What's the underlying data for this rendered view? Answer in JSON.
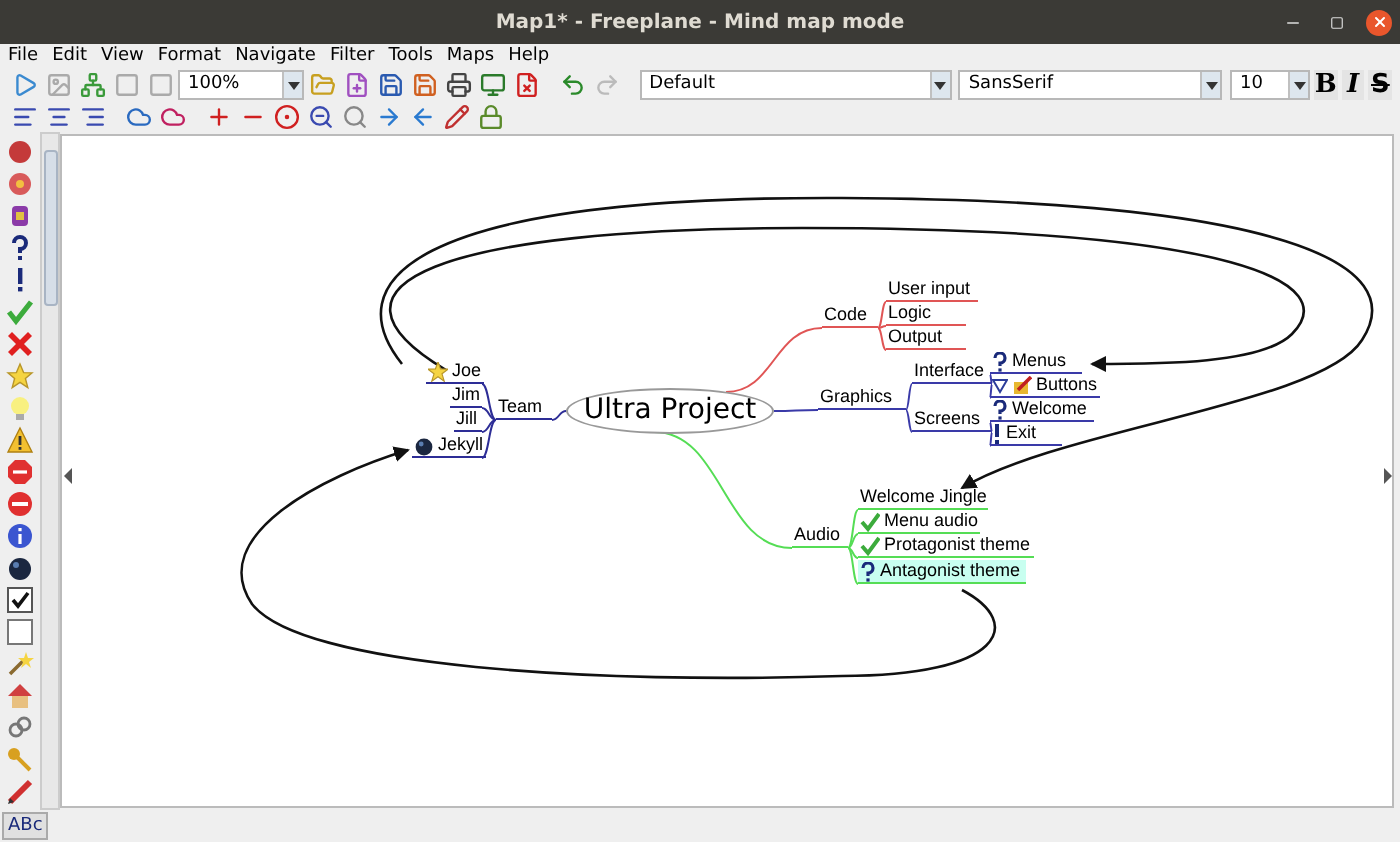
{
  "window": {
    "title": "Map1* - Freeplane - Mind map mode"
  },
  "menu": [
    "File",
    "Edit",
    "View",
    "Format",
    "Navigate",
    "Filter",
    "Tools",
    "Maps",
    "Help"
  ],
  "toolbar": {
    "zoom": "100%",
    "style": "Default",
    "font": "SansSerif",
    "size": "10",
    "format_buttons": [
      {
        "label": "B",
        "kind": "bold"
      },
      {
        "label": "I",
        "kind": "italic"
      },
      {
        "label": "S",
        "kind": "strike"
      }
    ]
  },
  "status_button": "ABc",
  "mind_map": {
    "root": {
      "text": "Ultra Project",
      "selected": false
    },
    "branches": [
      {
        "text": "Team",
        "color": "#2d2d96",
        "selected": false,
        "children": [
          {
            "text": "Joe",
            "icons": [
              {
                "kind": "star"
              }
            ],
            "selected": false
          },
          {
            "text": "Jim",
            "selected": false
          },
          {
            "text": "Jill",
            "selected": false
          },
          {
            "text": "Jekyll",
            "icons": [
              {
                "kind": "bomb"
              }
            ],
            "selected": false
          }
        ]
      },
      {
        "text": "Code",
        "color": "#e05555",
        "selected": false,
        "children": [
          {
            "text": "User input",
            "selected": false
          },
          {
            "text": "Logic",
            "selected": false
          },
          {
            "text": "Output",
            "selected": false
          }
        ]
      },
      {
        "text": "Graphics",
        "color": "#3a3aa8",
        "selected": false,
        "children": [
          {
            "text": "Interface",
            "selected": false,
            "children": [
              {
                "text": "Menus",
                "icons": [
                  {
                    "kind": "question"
                  }
                ],
                "selected": false
              },
              {
                "text": "Buttons",
                "icons": [
                  {
                    "kind": "triangle"
                  },
                  {
                    "kind": "pencil"
                  }
                ],
                "selected": false
              }
            ]
          },
          {
            "text": "Screens",
            "selected": false,
            "children": [
              {
                "text": "Welcome",
                "icons": [
                  {
                    "kind": "question"
                  }
                ],
                "selected": false
              },
              {
                "text": "Exit",
                "icons": [
                  {
                    "kind": "exclamation"
                  }
                ],
                "selected": false
              }
            ]
          }
        ]
      },
      {
        "text": "Audio",
        "color": "#55dd55",
        "selected": false,
        "children": [
          {
            "text": "Welcome Jingle",
            "selected": false
          },
          {
            "text": "Menu audio",
            "icons": [
              {
                "kind": "check"
              }
            ],
            "selected": false
          },
          {
            "text": "Protagonist theme",
            "icons": [
              {
                "kind": "check"
              }
            ],
            "selected": false
          },
          {
            "text": "Antagonist theme",
            "icons": [
              {
                "kind": "question"
              }
            ],
            "selected": true
          }
        ]
      }
    ]
  }
}
